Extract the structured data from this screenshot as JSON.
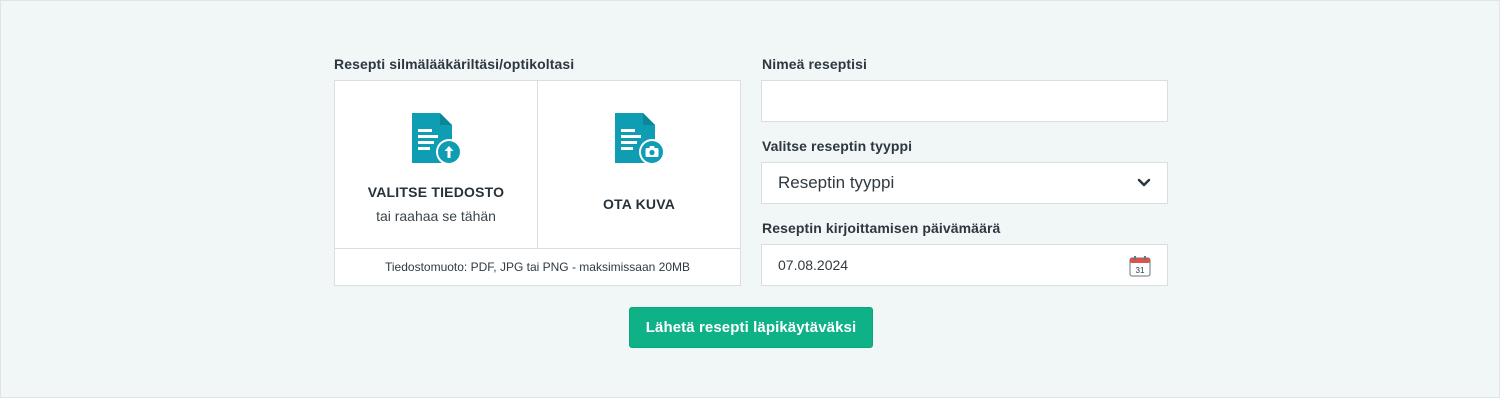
{
  "upload": {
    "label": "Resepti silmälääkäriltäsi/optikoltasi",
    "choose_file": {
      "title": "VALITSE TIEDOSTO",
      "subtitle": "tai raahaa se tähän",
      "icon": "document-upload-icon"
    },
    "take_photo": {
      "title": "OTA KUVA",
      "icon": "document-camera-icon"
    },
    "footer": "Tiedostomuoto: PDF, JPG tai PNG - maksimissaan 20MB"
  },
  "form": {
    "name_label": "Nimeä reseptisi",
    "name_value": "",
    "name_placeholder": "",
    "type_label": "Valitse reseptin tyyppi",
    "type_value": "Reseptin tyyppi",
    "date_label": "Reseptin kirjoittamisen päivämäärä",
    "date_value": "07.08.2024",
    "calendar_day": "31"
  },
  "submit_label": "Lähetä resepti läpikäytäväksi",
  "colors": {
    "accent": "#0fb287",
    "icon": "#0e9db2",
    "background": "#f1f6f6"
  }
}
